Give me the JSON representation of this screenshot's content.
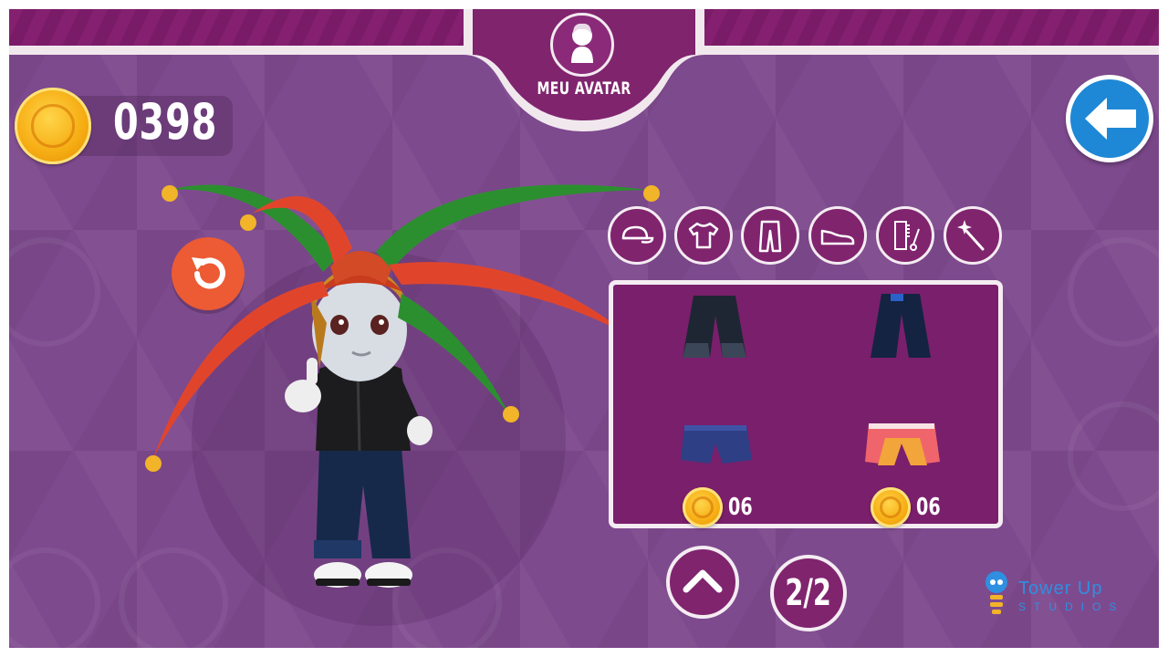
{
  "header": {
    "title": "MEU AVATAR",
    "icon": "avatar-silhouette-icon"
  },
  "wallet": {
    "coins": "0398",
    "icon": "coin-icon"
  },
  "buttons": {
    "back_icon": "arrow-left-icon",
    "reset_icon": "reset-icon",
    "page_up_icon": "chevron-up-icon"
  },
  "categories": [
    {
      "id": "hats",
      "icon": "cap-icon"
    },
    {
      "id": "shirts",
      "icon": "tshirt-icon"
    },
    {
      "id": "pants",
      "icon": "pants-icon"
    },
    {
      "id": "shoes",
      "icon": "sneaker-icon"
    },
    {
      "id": "hair",
      "icon": "comb-scissors-icon"
    },
    {
      "id": "extras",
      "icon": "magic-wand-icon"
    }
  ],
  "items": [
    {
      "name": "black-jeans",
      "price": ""
    },
    {
      "name": "navy-jeans",
      "price": ""
    },
    {
      "name": "blue-shorts",
      "price": "06"
    },
    {
      "name": "pink-orange-shorts",
      "price": "06"
    }
  ],
  "pagination": {
    "current": "2/2"
  },
  "brand": {
    "name": "Tower Up",
    "sub": "STUDIOS"
  },
  "colors": {
    "background": "#7e4a8e",
    "panel": "#7a1f6c",
    "accent_blue": "#1e88d6",
    "accent_orange": "#ec5b34",
    "coin_gold": "#f6ad13"
  }
}
